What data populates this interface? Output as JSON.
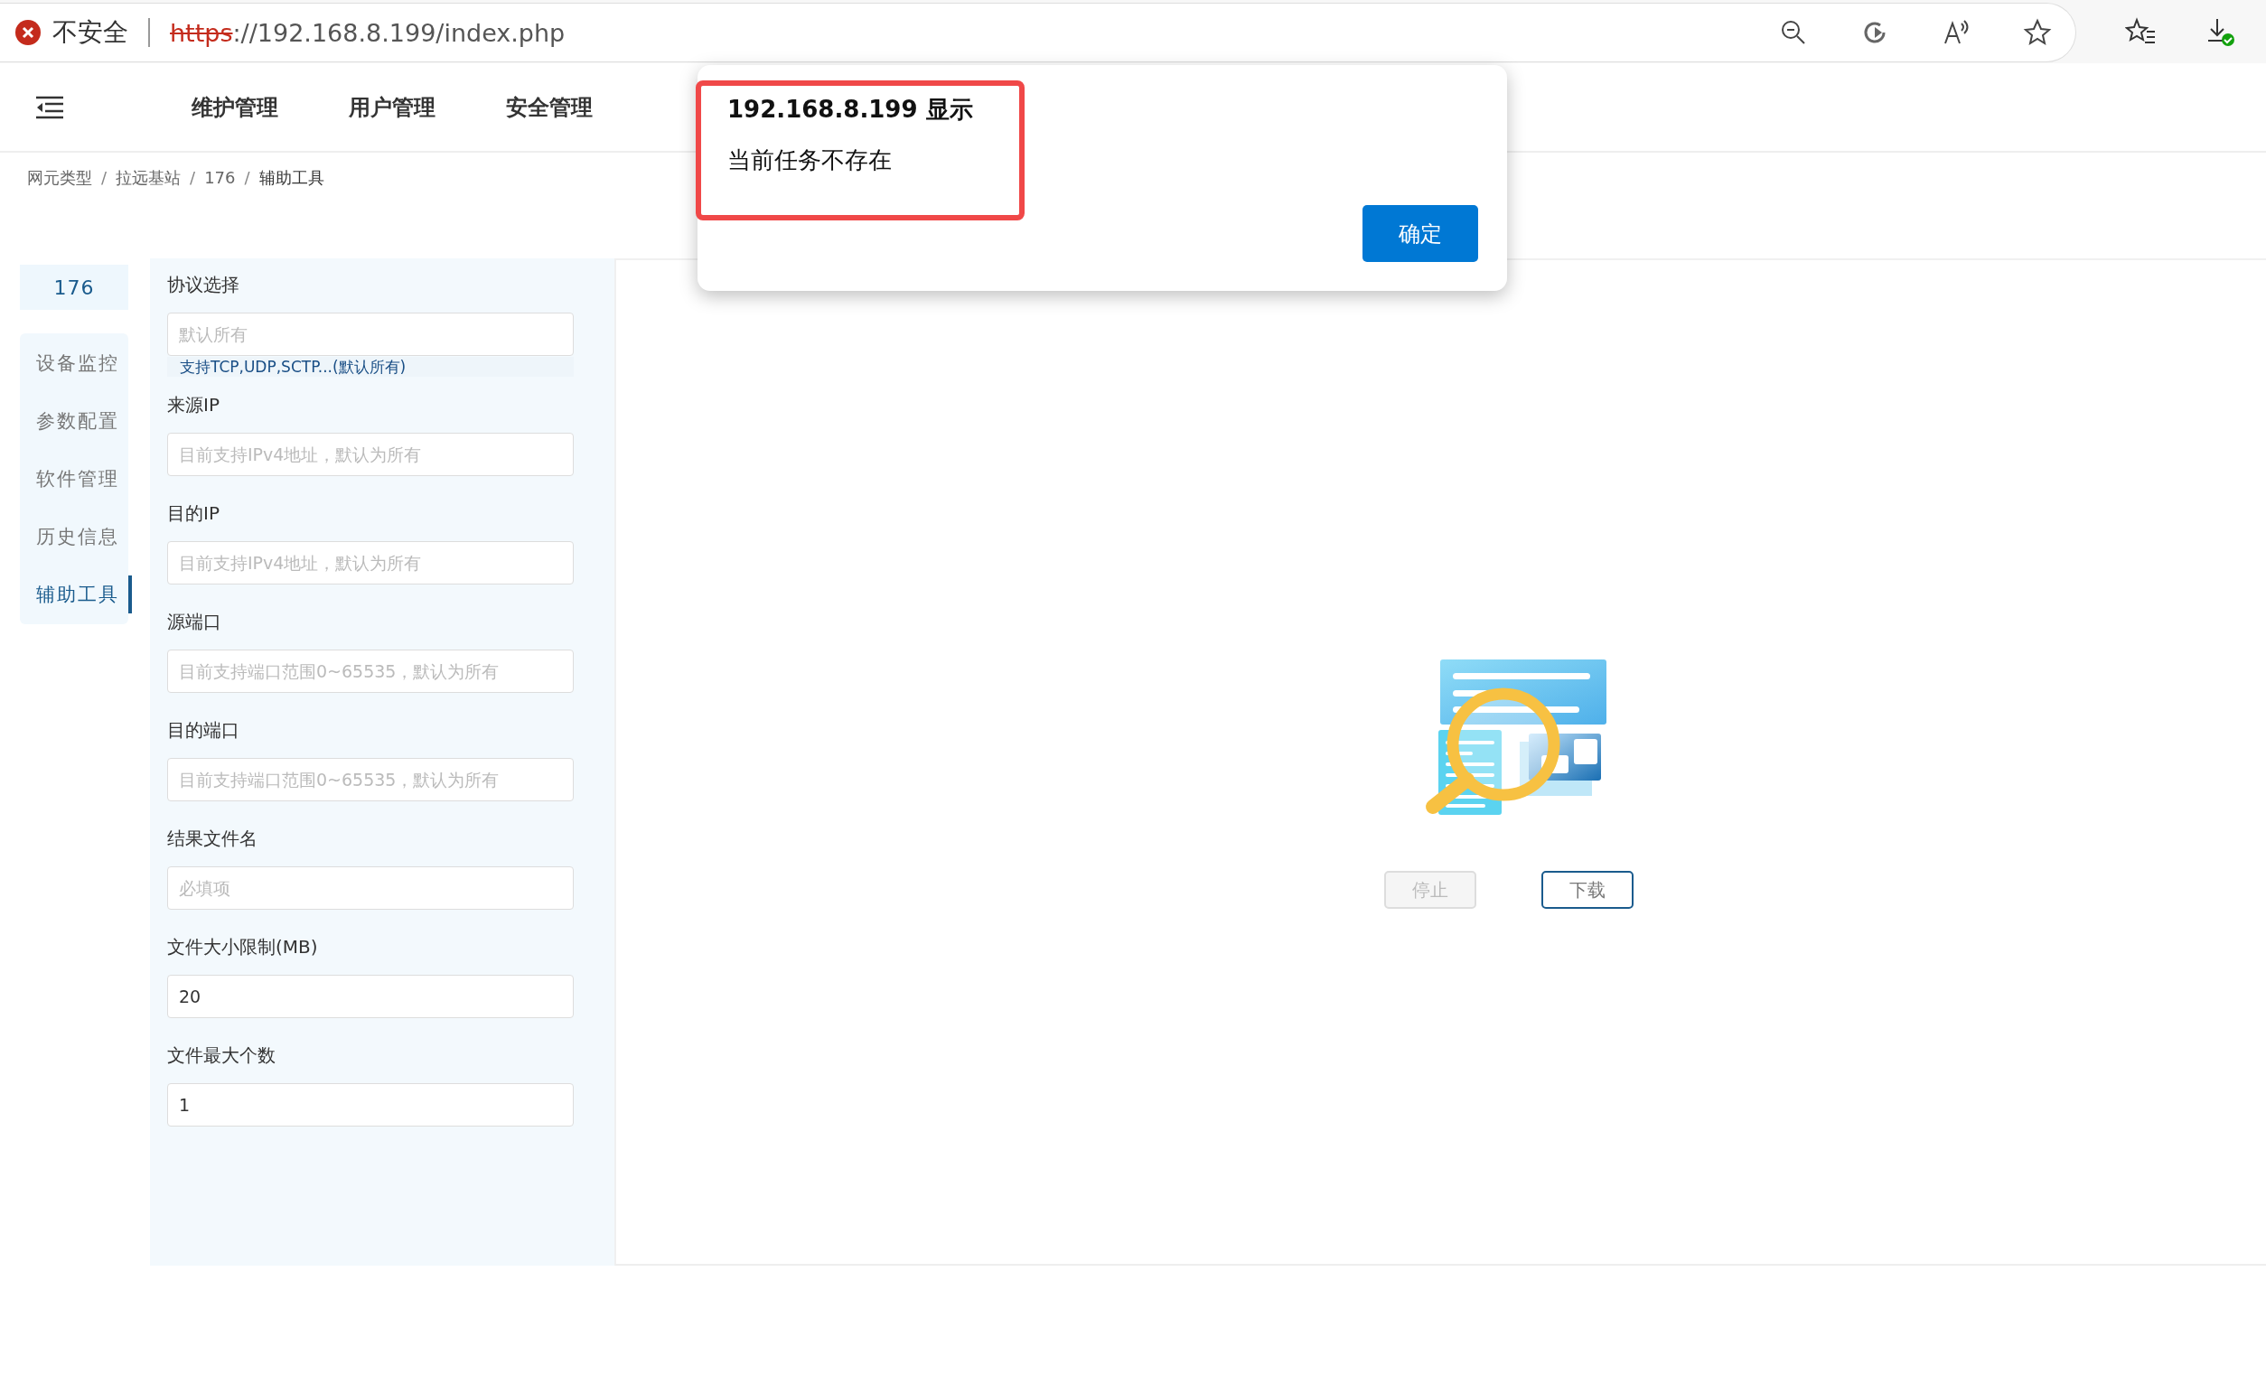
{
  "browser": {
    "security_label": "不安全",
    "url_scheme": "https",
    "url_rest": "://192.168.8.199/index.php"
  },
  "nav": {
    "items": [
      {
        "label": "维护管理"
      },
      {
        "label": "用户管理"
      },
      {
        "label": "安全管理"
      }
    ]
  },
  "breadcrumb": [
    {
      "kind": "link",
      "text": "网元类型"
    },
    {
      "kind": "separator",
      "text": "/"
    },
    {
      "kind": "link",
      "text": "拉远基站"
    },
    {
      "kind": "separator",
      "text": "/"
    },
    {
      "kind": "link",
      "text": "176"
    },
    {
      "kind": "separator",
      "text": "/"
    },
    {
      "kind": "current",
      "text": "辅助工具"
    }
  ],
  "sidebar": {
    "title": "176",
    "items": [
      {
        "label": "设备监控",
        "selected": false
      },
      {
        "label": "参数配置",
        "selected": false
      },
      {
        "label": "软件管理",
        "selected": false
      },
      {
        "label": "历史信息",
        "selected": false
      },
      {
        "label": "辅助工具",
        "selected": true
      }
    ]
  },
  "form": {
    "fields": [
      {
        "label": "协议选择",
        "placeholder": "默认所有",
        "hint": "支持TCP,UDP,SCTP...(默认所有)"
      },
      {
        "label": "来源IP",
        "placeholder": "目前支持IPv4地址，默认为所有"
      },
      {
        "label": "目的IP",
        "placeholder": "目前支持IPv4地址，默认为所有"
      },
      {
        "label": "源端口",
        "placeholder": "目前支持端口范围0~65535，默认为所有"
      },
      {
        "label": "目的端口",
        "placeholder": "目前支持端口范围0~65535，默认为所有"
      },
      {
        "label": "结果文件名",
        "placeholder": "必填项"
      },
      {
        "label": "文件大小限制(MB)",
        "value": "20"
      },
      {
        "label": "文件最大个数",
        "value": "1"
      }
    ]
  },
  "actions": [
    {
      "label": "停止",
      "disabled": true
    },
    {
      "label": "下载",
      "disabled": false
    }
  ],
  "dialog": {
    "title": "192.168.8.199 显示",
    "message": "当前任务不存在",
    "button": "确定",
    "highlighted": true
  }
}
